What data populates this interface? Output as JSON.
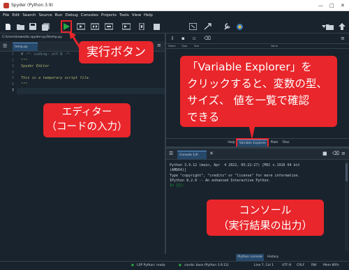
{
  "window": {
    "title": "Spyder (Python 3.9)",
    "minimize": "—",
    "maximize": "□",
    "close": "✕"
  },
  "menu": [
    "File",
    "Edit",
    "Search",
    "Source",
    "Run",
    "Debug",
    "Consoles",
    "Projects",
    "Tools",
    "View",
    "Help"
  ],
  "toolbar": {
    "icons": [
      "new-file-icon",
      "open-file-icon",
      "save-icon",
      "save-all-icon",
      "run-icon",
      "run-cell-icon",
      "run-cell-advance-icon",
      "run-selection-icon",
      "debug-icon",
      "profile-icon",
      "stop-icon",
      "maximize-pane-icon",
      "preferences-icon",
      "python-path-icon"
    ],
    "working_dir": "C:\\Users\\kawada",
    "back_icon": "back-arrow-icon",
    "folder_icon": "folder-icon",
    "up_icon": "up-arrow-icon"
  },
  "editor": {
    "path": "C:\\Users\\kawada\\.spyder-py3\\temp.py",
    "tab": "temp.py",
    "lines": [
      "# -*- coding: utf-8 -*-",
      "\"\"\"",
      "Spyder Editor",
      "",
      "This is a temporary script file.",
      "\"\"\"",
      ""
    ],
    "line_numbers": [
      "1",
      "2",
      "3",
      "4",
      "5",
      "6",
      "7"
    ]
  },
  "variable_explorer": {
    "columns": [
      "Name",
      "Type",
      "Size",
      "Value"
    ],
    "tabs": [
      "Help",
      "Variable Explorer",
      "Plots",
      "Files"
    ],
    "active_tab": "Variable Explorer"
  },
  "console": {
    "tab": "Console 1/A",
    "lines": [
      "Python 3.9.12 (main, Apr  4 2022, 05:22:27) [MSC v.1916 64 bit",
      "(AMD64)]",
      "Type \"copyright\", \"credits\" or \"license\" for more information.",
      "",
      "IPython 8.2.0 -- An enhanced Interactive Python.",
      "",
      "In [1]:"
    ],
    "bottom_tabs": [
      "IPython console",
      "History"
    ]
  },
  "statusbar": {
    "lsp": "LSP Python: ready",
    "conda": "conda: base (Python 3.9.12)",
    "position": "Line 7, Col 1",
    "encoding": "UTF-8",
    "eol": "CRLF",
    "rw": "RW",
    "mem": "Mem 80%"
  },
  "annotations": {
    "run_button": "実行ボタン",
    "variable_explorer": [
      "「Variable Explorer」を",
      "クリックすると、変数の型、",
      "サイズ、 値を一覧で確認",
      "できる"
    ],
    "editor": [
      "エディター",
      "（コードの入力）"
    ],
    "console": [
      "コンソール",
      "（実行結果の出力）"
    ]
  },
  "colors": {
    "background": "#19232d",
    "highlight": "#e8262b",
    "tab_active": "#26486b",
    "prompt": "#1ba038"
  }
}
